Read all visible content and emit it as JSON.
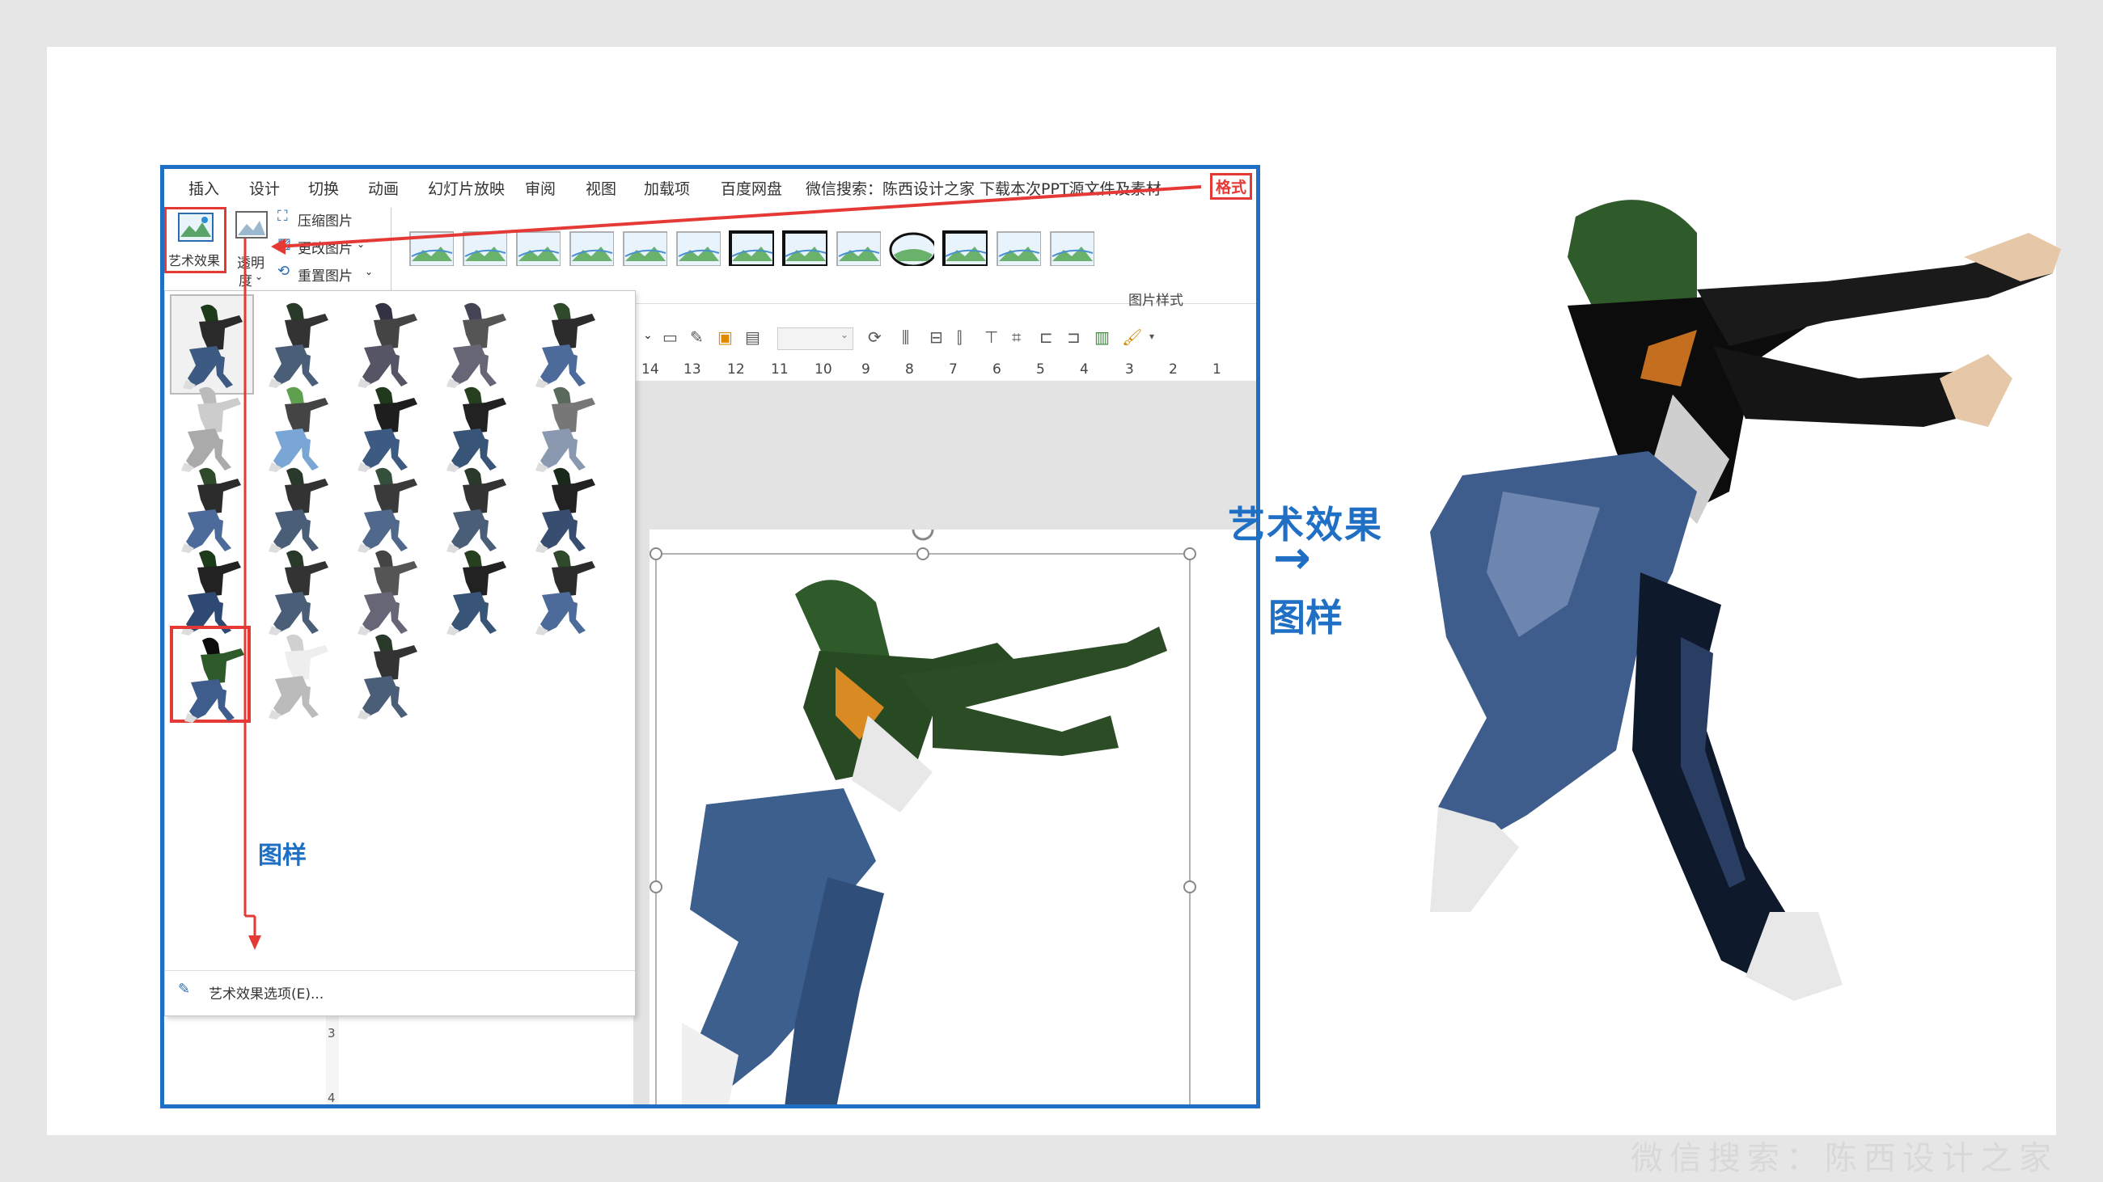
{
  "menu": {
    "items": [
      "插入",
      "设计",
      "切换",
      "动画",
      "幻灯片放映",
      "审阅",
      "视图",
      "加载项",
      "百度网盘"
    ],
    "notice": "微信搜索：陈西设计之家  下载本次PPT源文件及素材",
    "format_tab": "格式"
  },
  "ribbon": {
    "art_effects_label": "艺术效果",
    "transparency_label_1": "透明",
    "transparency_label_2": "度",
    "compress_label": "压缩图片",
    "change_label": "更改图片",
    "reset_label": "重置图片",
    "styles_group_label": "图片样式"
  },
  "ruler": {
    "ticks": [
      "14",
      "13",
      "12",
      "11",
      "10",
      "9",
      "8",
      "7",
      "6",
      "5",
      "4",
      "3",
      "2",
      "1"
    ]
  },
  "vruler": {
    "ticks": [
      "3",
      "4"
    ]
  },
  "gallery": {
    "selected_effect_label": "图样",
    "options_link": "艺术效果选项(E)..."
  },
  "annotation": {
    "title": "艺术效果",
    "arrow": "→",
    "subtitle": "图样"
  },
  "watermark": "微信搜索：陈西设计之家",
  "colors": {
    "accent_blue": "#1f6fc5",
    "highlight_red": "#e53935"
  }
}
